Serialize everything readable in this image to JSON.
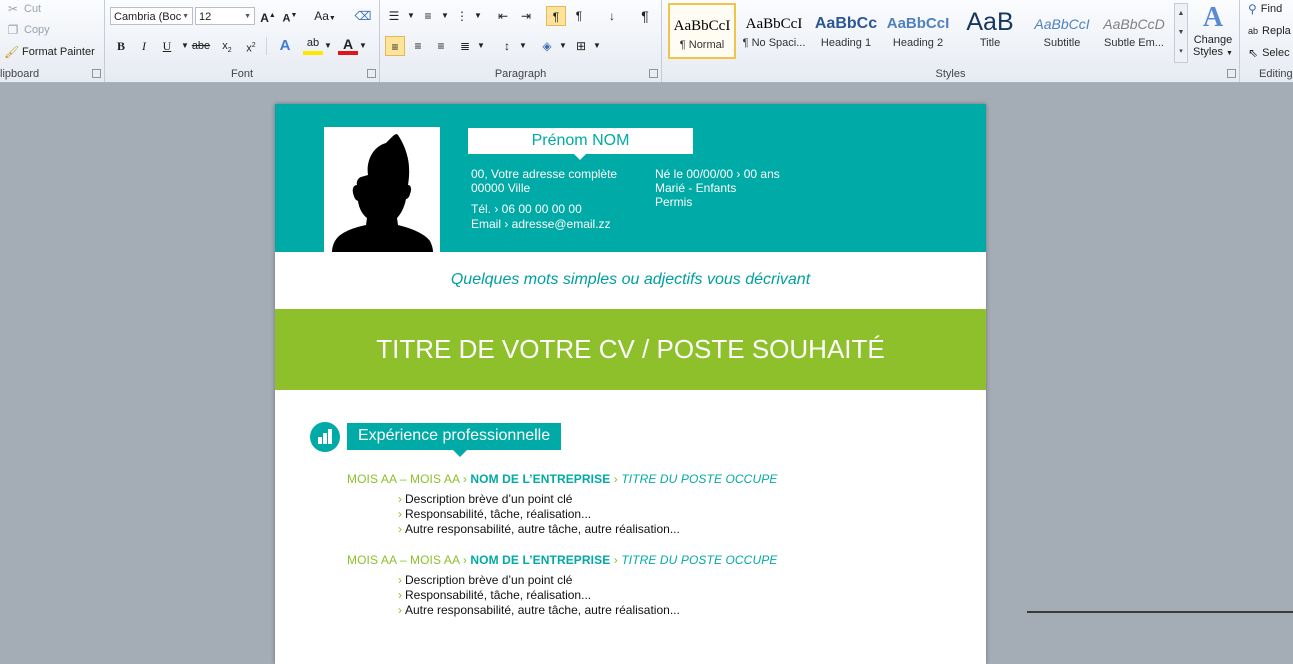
{
  "ribbon": {
    "clipboard": {
      "group_label": "lipboard",
      "cut": "Cut",
      "copy": "Copy",
      "format_painter": "Format Painter"
    },
    "font": {
      "group_label": "Font",
      "font_name": "Cambria (Boc",
      "font_size": "12",
      "case_label": "Aa"
    },
    "paragraph": {
      "group_label": "Paragraph"
    },
    "styles": {
      "group_label": "Styles",
      "items": [
        {
          "preview": "AaBbCcI",
          "name": "¶ Normal"
        },
        {
          "preview": "AaBbCcI",
          "name": "¶ No Spaci..."
        },
        {
          "preview": "AaBbCc",
          "name": "Heading 1"
        },
        {
          "preview": "AaBbCcI",
          "name": "Heading 2"
        },
        {
          "preview": "AaB",
          "name": "Title"
        },
        {
          "preview": "AaBbCcI",
          "name": "Subtitle"
        },
        {
          "preview": "AaBbCcD",
          "name": "Subtle Em..."
        }
      ],
      "change_styles_line1": "Change",
      "change_styles_line2": "Styles"
    },
    "editing": {
      "group_label": "Editing",
      "find": "Find",
      "replace": "Repla",
      "select": "Selec"
    }
  },
  "cv": {
    "name": "Prénom NOM",
    "address_line1": "00, Votre adresse complète",
    "address_line2": "00000 Ville",
    "phone": "Tél. › 06 00 00 00 00",
    "email": "Email › adresse@email.zz",
    "birth": "Né le 00/00/00 › 00 ans",
    "family": "Marié - Enfants",
    "license": "Permis",
    "tagline": "Quelques mots simples ou adjectifs vous décrivant",
    "title": "TITRE DE VOTRE CV / POSTE SOUHAITÉ",
    "section_title": "Expérience professionnelle",
    "jobs": [
      {
        "dates": "MOIS AA – MOIS AA",
        "company": "NOM DE L’ENTREPRISE",
        "position": "TITRE DU POSTE OCCUPE",
        "bullets": [
          "Description brève d’un point clé",
          "Responsabilité, tâche, réalisation...",
          "Autre responsabilité, autre tâche, autre réalisation..."
        ]
      },
      {
        "dates": "MOIS AA – MOIS AA",
        "company": "NOM DE L’ENTREPRISE",
        "position": "TITRE DU POSTE OCCUPE",
        "bullets": [
          "Description brève d’un point clé",
          "Responsabilité, tâche, réalisation...",
          "Autre responsabilité, autre tâche, autre réalisation..."
        ]
      }
    ]
  },
  "colors": {
    "teal": "#00aaa6",
    "green": "#8dc02b",
    "workspace": "#a4acb6"
  }
}
